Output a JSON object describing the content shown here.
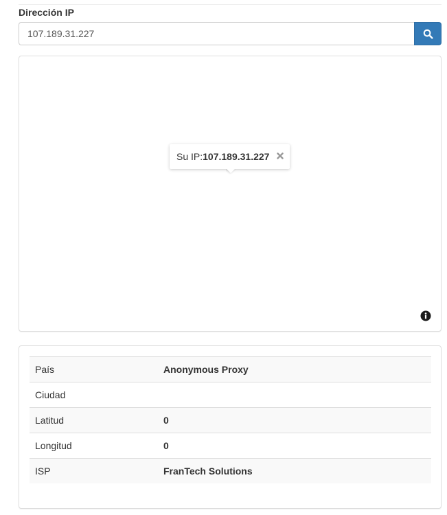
{
  "ip_form": {
    "label": "Dirección IP",
    "value": "107.189.31.227",
    "search_icon": "search-icon"
  },
  "map": {
    "popup": {
      "prefix": "Su IP: ",
      "ip": "107.189.31.227",
      "close_icon": "close-icon"
    },
    "info_icon": "info-icon"
  },
  "details": {
    "rows": [
      {
        "key": "País",
        "value": "Anonymous Proxy"
      },
      {
        "key": "Ciudad",
        "value": ""
      },
      {
        "key": "Latitud",
        "value": "0"
      },
      {
        "key": "Longitud",
        "value": "0"
      },
      {
        "key": "ISP",
        "value": "FranTech Solutions"
      }
    ]
  },
  "colors": {
    "primary_button": "#337ab7",
    "panel_border": "#dddddd",
    "row_stripe": "#f9f9f9"
  }
}
